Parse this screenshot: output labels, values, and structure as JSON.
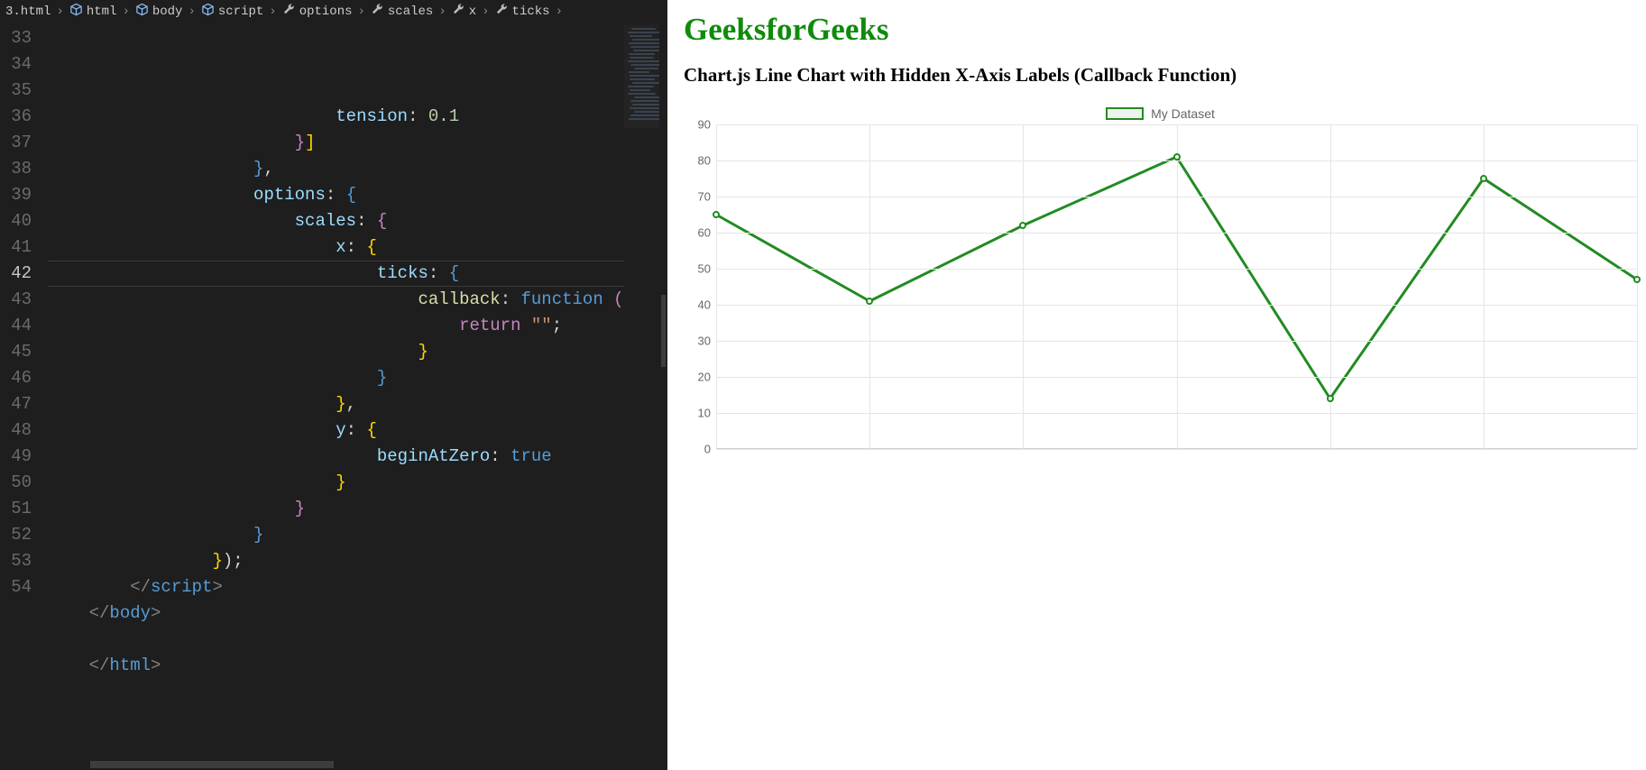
{
  "breadcrumb": {
    "file": "3.html",
    "path": [
      "html",
      "body",
      "script",
      "options",
      "scales",
      "x",
      "ticks"
    ],
    "path_icons": [
      "cube",
      "cube",
      "cube",
      "wrench",
      "wrench",
      "wrench",
      "wrench"
    ]
  },
  "editor": {
    "first_line_number": 33,
    "current_line_number": 42,
    "lines": [
      {
        "indent": 28,
        "tokens": [
          {
            "t": "prop",
            "v": "tension"
          },
          {
            "t": "pun",
            "v": ": "
          },
          {
            "t": "num",
            "v": "0.1"
          }
        ]
      },
      {
        "indent": 24,
        "tokens": [
          {
            "t": "brc1",
            "v": "}"
          },
          {
            "t": "brkt",
            "v": "]"
          }
        ]
      },
      {
        "indent": 20,
        "tokens": [
          {
            "t": "brc2",
            "v": "}"
          },
          {
            "t": "pun",
            "v": ","
          }
        ]
      },
      {
        "indent": 20,
        "tokens": [
          {
            "t": "prop",
            "v": "options"
          },
          {
            "t": "pun",
            "v": ": "
          },
          {
            "t": "brc2",
            "v": "{"
          }
        ]
      },
      {
        "indent": 24,
        "tokens": [
          {
            "t": "prop",
            "v": "scales"
          },
          {
            "t": "pun",
            "v": ": "
          },
          {
            "t": "brc1",
            "v": "{"
          }
        ]
      },
      {
        "indent": 28,
        "tokens": [
          {
            "t": "prop",
            "v": "x"
          },
          {
            "t": "pun",
            "v": ": "
          },
          {
            "t": "brkt",
            "v": "{"
          }
        ]
      },
      {
        "indent": 32,
        "tokens": [
          {
            "t": "prop",
            "v": "ticks"
          },
          {
            "t": "pun",
            "v": ": "
          },
          {
            "t": "brc2",
            "v": "{"
          }
        ]
      },
      {
        "indent": 36,
        "tokens": [
          {
            "t": "kw",
            "v": "callback"
          },
          {
            "t": "pun",
            "v": ": "
          },
          {
            "t": "kw2",
            "v": "function"
          },
          {
            "t": "pun",
            "v": " "
          },
          {
            "t": "brc1",
            "v": "("
          }
        ]
      },
      {
        "indent": 40,
        "tokens": [
          {
            "t": "brc1",
            "v": "return"
          },
          {
            "t": "pun",
            "v": " "
          },
          {
            "t": "str",
            "v": "\"\""
          },
          {
            "t": "pun",
            "v": ";"
          }
        ]
      },
      {
        "indent": 36,
        "tokens": [
          {
            "t": "brkt",
            "v": "}"
          }
        ]
      },
      {
        "indent": 32,
        "tokens": [
          {
            "t": "brc2",
            "v": "}"
          }
        ]
      },
      {
        "indent": 28,
        "tokens": [
          {
            "t": "brkt",
            "v": "}"
          },
          {
            "t": "pun",
            "v": ","
          }
        ]
      },
      {
        "indent": 28,
        "tokens": [
          {
            "t": "prop",
            "v": "y"
          },
          {
            "t": "pun",
            "v": ": "
          },
          {
            "t": "brkt",
            "v": "{"
          }
        ]
      },
      {
        "indent": 32,
        "tokens": [
          {
            "t": "prop",
            "v": "beginAtZero"
          },
          {
            "t": "pun",
            "v": ": "
          },
          {
            "t": "kw2",
            "v": "true"
          }
        ]
      },
      {
        "indent": 28,
        "tokens": [
          {
            "t": "brkt",
            "v": "}"
          }
        ]
      },
      {
        "indent": 24,
        "tokens": [
          {
            "t": "brc1",
            "v": "}"
          }
        ]
      },
      {
        "indent": 20,
        "tokens": [
          {
            "t": "brc2",
            "v": "}"
          }
        ]
      },
      {
        "indent": 16,
        "tokens": [
          {
            "t": "brkt",
            "v": "}"
          },
          {
            "t": "pun",
            "v": ")"
          },
          {
            "t": "pun",
            "v": ";"
          }
        ]
      },
      {
        "indent": 8,
        "tokens": [
          {
            "t": "ang",
            "v": "</"
          },
          {
            "t": "tag",
            "v": "script"
          },
          {
            "t": "ang",
            "v": ">"
          }
        ]
      },
      {
        "indent": 4,
        "tokens": [
          {
            "t": "ang",
            "v": "</"
          },
          {
            "t": "tag",
            "v": "body"
          },
          {
            "t": "ang",
            "v": ">"
          }
        ]
      },
      {
        "indent": 4,
        "tokens": []
      },
      {
        "indent": 4,
        "tokens": [
          {
            "t": "ang",
            "v": "</"
          },
          {
            "t": "tag",
            "v": "html"
          },
          {
            "t": "ang",
            "v": ">"
          }
        ]
      }
    ]
  },
  "preview": {
    "brand": "GeeksforGeeks",
    "subtitle": "Chart.js Line Chart with Hidden X-Axis Labels (Callback Function)",
    "legend_label": "My Dataset"
  },
  "chart_data": {
    "type": "line",
    "title": "",
    "xlabel": "",
    "ylabel": "",
    "ylim": [
      0,
      90
    ],
    "yticks": [
      0,
      10,
      20,
      30,
      40,
      50,
      60,
      70,
      80,
      90
    ],
    "x_count": 7,
    "series": [
      {
        "name": "My Dataset",
        "values": [
          65,
          41,
          62,
          81,
          14,
          75,
          47
        ],
        "color": "#228b22"
      }
    ]
  }
}
